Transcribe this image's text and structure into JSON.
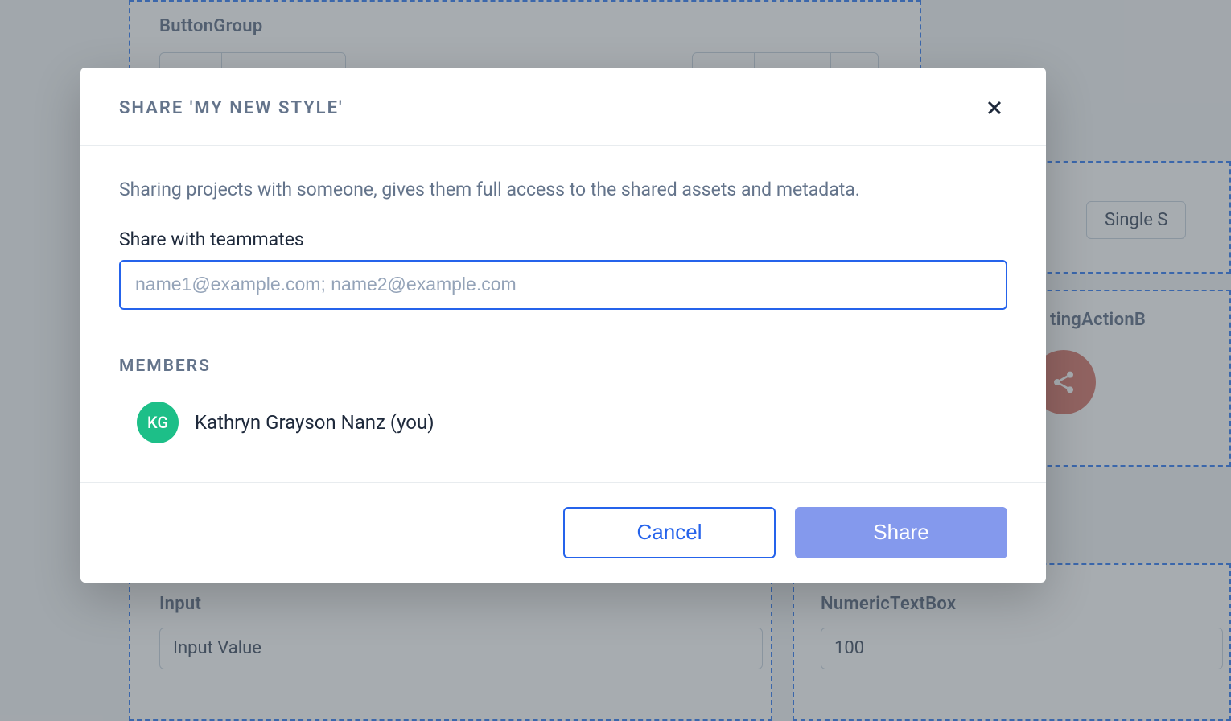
{
  "background": {
    "buttonGroupLabel": "ButtonGroup",
    "inputLabel": "Input",
    "inputValue": "Input Value",
    "numericTextBoxLabel": "NumericTextBox",
    "numericValue": "100",
    "floatingActionLabel": "tingActionB",
    "singleButtonLabel": "Single S"
  },
  "modal": {
    "title": "SHARE 'MY NEW STYLE'",
    "description": "Sharing projects with someone, gives them full access to the shared assets and metadata.",
    "shareLabel": "Share with teammates",
    "emailPlaceholder": "name1@example.com; name2@example.com",
    "membersHeading": "MEMBERS",
    "members": [
      {
        "initials": "KG",
        "name": "Kathryn Grayson Nanz (you)"
      }
    ],
    "cancelLabel": "Cancel",
    "shareButtonLabel": "Share"
  }
}
